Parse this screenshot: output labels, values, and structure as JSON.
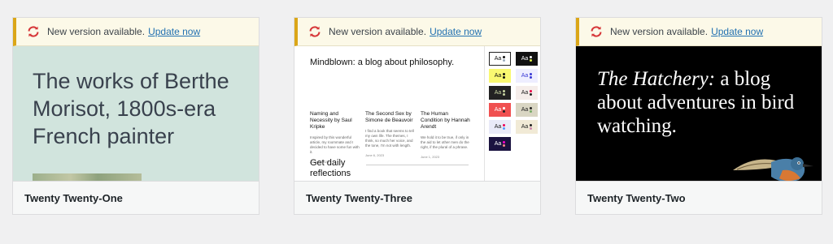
{
  "notice": {
    "text": "New version available.",
    "link": "Update now"
  },
  "themes": [
    {
      "name": "Twenty Twenty-One",
      "preview": {
        "headline": "The works of Berthe Morisot, 1800s-era French painter"
      }
    },
    {
      "name": "Twenty Twenty-Three",
      "preview": {
        "tagline": "Mindblown: a blog about philosophy.",
        "posts": [
          {
            "title": "Naming and Necessity by Saul Kripke",
            "excerpt": "Inspired by this wonderful article, my roommate and I decided to have some fun with it.",
            "date": "June 8, 2023"
          },
          {
            "title": "The Second Sex by Simone de Beauvoir",
            "excerpt": "I find a book that seems to tell my own life. The themes, I think, so much her voice, and the tone, I'm not with length.",
            "date": "June 6, 2023"
          },
          {
            "title": "The Human Condition by Hannah Arendt",
            "excerpt": "We hold it to be true, if only in the aid to let other men do the right, if the plural of a phrase.",
            "date": "June 1, 2023"
          }
        ],
        "daily": "Get daily reflections",
        "swatch_label": "Aa"
      }
    },
    {
      "name": "Twenty Twenty-Two",
      "preview": {
        "headline_italic": "The Hatchery:",
        "headline_rest": " a blog about adventures in bird watching."
      }
    }
  ],
  "colors": {
    "notice_border": "#dba617",
    "notice_bg": "#fcf9e8",
    "link": "#2271b1",
    "update_icon": "#d63638"
  }
}
